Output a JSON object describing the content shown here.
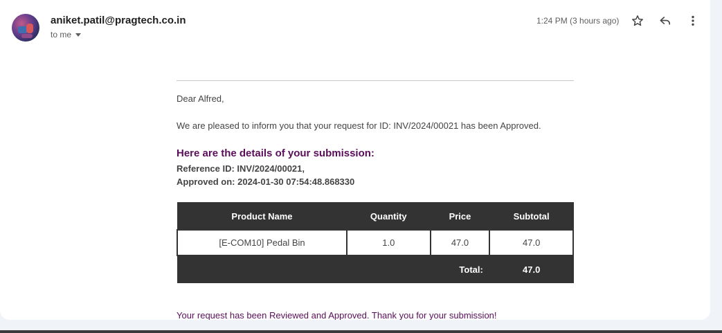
{
  "header": {
    "sender": "aniket.patil@pragtech.co.in",
    "recipient_label": "to me",
    "timestamp": "1:24 PM (3 hours ago)",
    "icons": [
      "star-icon",
      "reply-icon",
      "more-vert-icon"
    ]
  },
  "email": {
    "greeting": "Dear Alfred,",
    "inform_text": "We are pleased to inform you that your request for ID: INV/2024/00021 has been Approved.",
    "details_heading": "Here are the details of your submission:",
    "reference_line": "Reference ID: INV/2024/00021,",
    "approved_line": "Approved on: 2024-01-30 07:54:48.868330",
    "closing": "Your request has been Reviewed and Approved. Thank you for your submission!"
  },
  "table": {
    "headers": [
      "Product Name",
      "Quantity",
      "Price",
      "Subtotal"
    ],
    "rows": [
      [
        "[E-COM10] Pedal Bin",
        "1.0",
        "47.0",
        "47.0"
      ]
    ],
    "total_label": "Total:",
    "total_value": "47.0"
  },
  "colors": {
    "accent_purple": "#5a0e5a",
    "table_dark": "#333333"
  }
}
